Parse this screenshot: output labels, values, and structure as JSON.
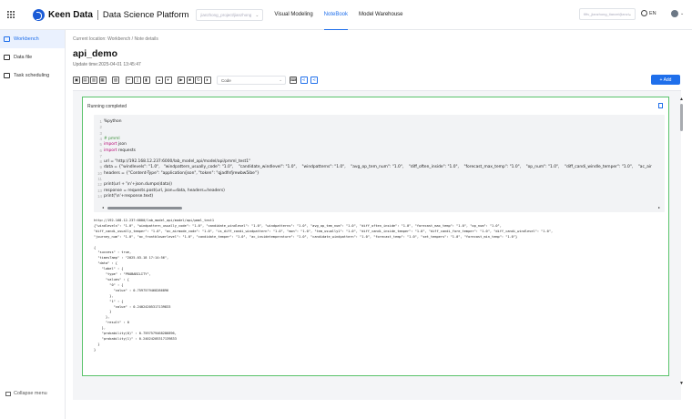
{
  "header": {
    "brand": "Keen Data",
    "platform": "Data Science Platform",
    "project_select": "jianzhong_project/jianzhong",
    "nav": [
      "Visual Modeling",
      "NoteBook",
      "Model Warehouse"
    ],
    "active_nav": "NoteBook",
    "env_select": "fiftv_jianzhong_tianzei/jianzl",
    "language": "EN"
  },
  "sidebar": {
    "items": [
      {
        "label": "Workbench",
        "icon": "workbench-icon",
        "active": true
      },
      {
        "label": "Data file",
        "icon": "folder-icon",
        "active": false
      },
      {
        "label": "Task scheduling",
        "icon": "schedule-icon",
        "active": false
      }
    ],
    "collapse_label": "Collapse menu"
  },
  "breadcrumb": "Current location: Workbench  /  Note details",
  "title": "api_demo",
  "update_time": "Update time:2025-04-01 13:45:47",
  "toolbar": {
    "cell_type": "Code",
    "add_label": "+ Add"
  },
  "cell": {
    "status": "Running completed",
    "code_lines": [
      {
        "n": "1",
        "t": "%python",
        "k": "plain"
      },
      {
        "n": "2",
        "t": "",
        "k": "plain"
      },
      {
        "n": "3",
        "t": "",
        "k": "plain"
      },
      {
        "n": "4",
        "t": "# pmml",
        "k": "comment"
      },
      {
        "n": "5",
        "t": "import json",
        "k": "import"
      },
      {
        "n": "6",
        "t": "import requests",
        "k": "import"
      },
      {
        "n": "7",
        "t": "",
        "k": "plain"
      },
      {
        "n": "8",
        "t": "url = \"http://192.168.12.237:6000/lab_model_api/model/api/pmml_test1\"",
        "k": "plain"
      },
      {
        "n": "9",
        "t": "data = {\"windlevels\": \"1.0\",   \"windpattern_usually_code\": \"1.0\",    \"candidate_windlevel\": \"1.0\",    \"windpatterns\": \"1.0\",    \"avg_op_tem_num\": \"1.0\",    \"diff_often_inside\": \"1.0\",    \"forecast_max_temp\": \"1.0\",    \"op_num\": \"1.0\",    \"diff_candi_windle_temper\": \"1.0\",    \"ac_air",
        "k": "plain"
      },
      {
        "n": "10",
        "t": "headers = {\"Content-Type\": \"application/json\", \"token\": \"qjadfnfjrewbw5ibe\"}",
        "k": "plain"
      },
      {
        "n": "11",
        "t": "",
        "k": "plain"
      },
      {
        "n": "12",
        "t": "print(url + '\\n'+json.dumps(data))",
        "k": "plain"
      },
      {
        "n": "13",
        "t": "response = requests.post(url, json=data, headers=headers)",
        "k": "plain"
      },
      {
        "n": "14",
        "t": "print('\\n'+response.text)",
        "k": "plain"
      }
    ],
    "output_lines": [
      "http://192.168.12.237:6000/lab_model_api/model/api/pmml_test1",
      "{\"windlevels\": \"1.0\", \"windpattern_usually_code\": \"1.0\", \"candidate_windlevel\": \"1.0\", \"windpatterns\": \"1.0\", \"avg_op_tem_num\": \"1.0\", \"diff_often_inside\": \"1.0\", \"forecast_max_temp\": \"1.0\", \"op_num\": \"1.0\",",
      "\"diff_candi_usually_temper\": \"1.0\", \"ac_airmode_code\": \"1.0\", \"is_diff_candi_windpattern\": \"1.0\", \"mon\": \"1.0\", \"tem_usually1\": \"1.0\", \"diff_candi_inside_temper\": \"1.0\", \"diff_candi_fore_temper\": \"1.0\", \"diff_candi_windlevel\": \"1.0\",",
      "\"journey_num\": \"1.0\", \"ac_frontblowerlevel\": \"1.0\", \"candidate_temper\": \"1.0\", \"ac_insidetemperature\": \"1.0\", \"candidate_windpattern\": \"1.0\", \"forecast_temp\": \"1.0\", \"set_tempers\": \"1.0\", \"forecast_min_temp\": \"1.0\"}",
      "",
      "{",
      "  \"success\" : true,",
      "  \"timesTamp\" : \"2025-03-18 17:14:56\",",
      "  \"data\" : {",
      "    \"label\" : {",
      "      \"type\" : \"PROBABILITY\",",
      "      \"values\" : {",
      "        \"0\" : {",
      "          \"value\" : 0.7597579468286896",
      "        },",
      "        \"1\" : {",
      "          \"value\" : 0.24024205317139833",
      "        }",
      "      },",
      "      \"result\" : 0",
      "    },",
      "    \"probability(0)\" : 0.7597579468286896,",
      "    \"probability(1)\" : 0.24024205317139833",
      "  }",
      "}"
    ]
  }
}
